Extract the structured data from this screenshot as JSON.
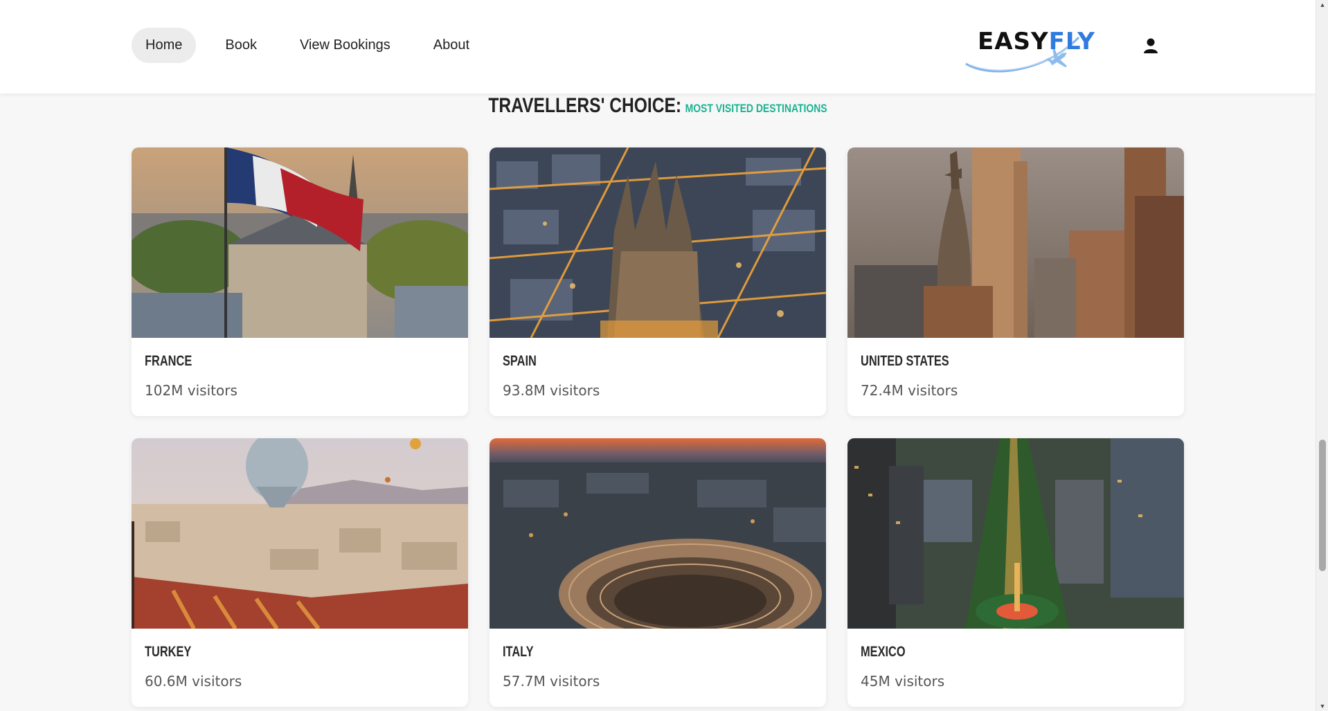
{
  "nav": {
    "items": [
      {
        "label": "Home",
        "active": true
      },
      {
        "label": "Book",
        "active": false
      },
      {
        "label": "View Bookings",
        "active": false
      },
      {
        "label": "About",
        "active": false
      }
    ],
    "logo": {
      "easy": "EASY",
      "fly": "FLY"
    },
    "user_icon": "user-icon"
  },
  "section": {
    "title": "TRAVELLERS' CHOICE:",
    "subtitle": "MOST VISITED DESTINATIONS"
  },
  "destinations": [
    {
      "name": "FRANCE",
      "visitors": "102M visitors",
      "image": "france-icon"
    },
    {
      "name": "SPAIN",
      "visitors": "93.8M visitors",
      "image": "spain-icon"
    },
    {
      "name": "UNITED STATES",
      "visitors": "72.4M visitors",
      "image": "united-states-icon"
    },
    {
      "name": "TURKEY",
      "visitors": "60.6M visitors",
      "image": "turkey-icon"
    },
    {
      "name": "ITALY",
      "visitors": "57.7M visitors",
      "image": "italy-icon"
    },
    {
      "name": "MEXICO",
      "visitors": "45M visitors",
      "image": "mexico-icon"
    }
  ],
  "colors": {
    "accent_green": "#1bb393",
    "logo_blue": "#2f7be0",
    "nav_active_bg": "#ececec"
  }
}
